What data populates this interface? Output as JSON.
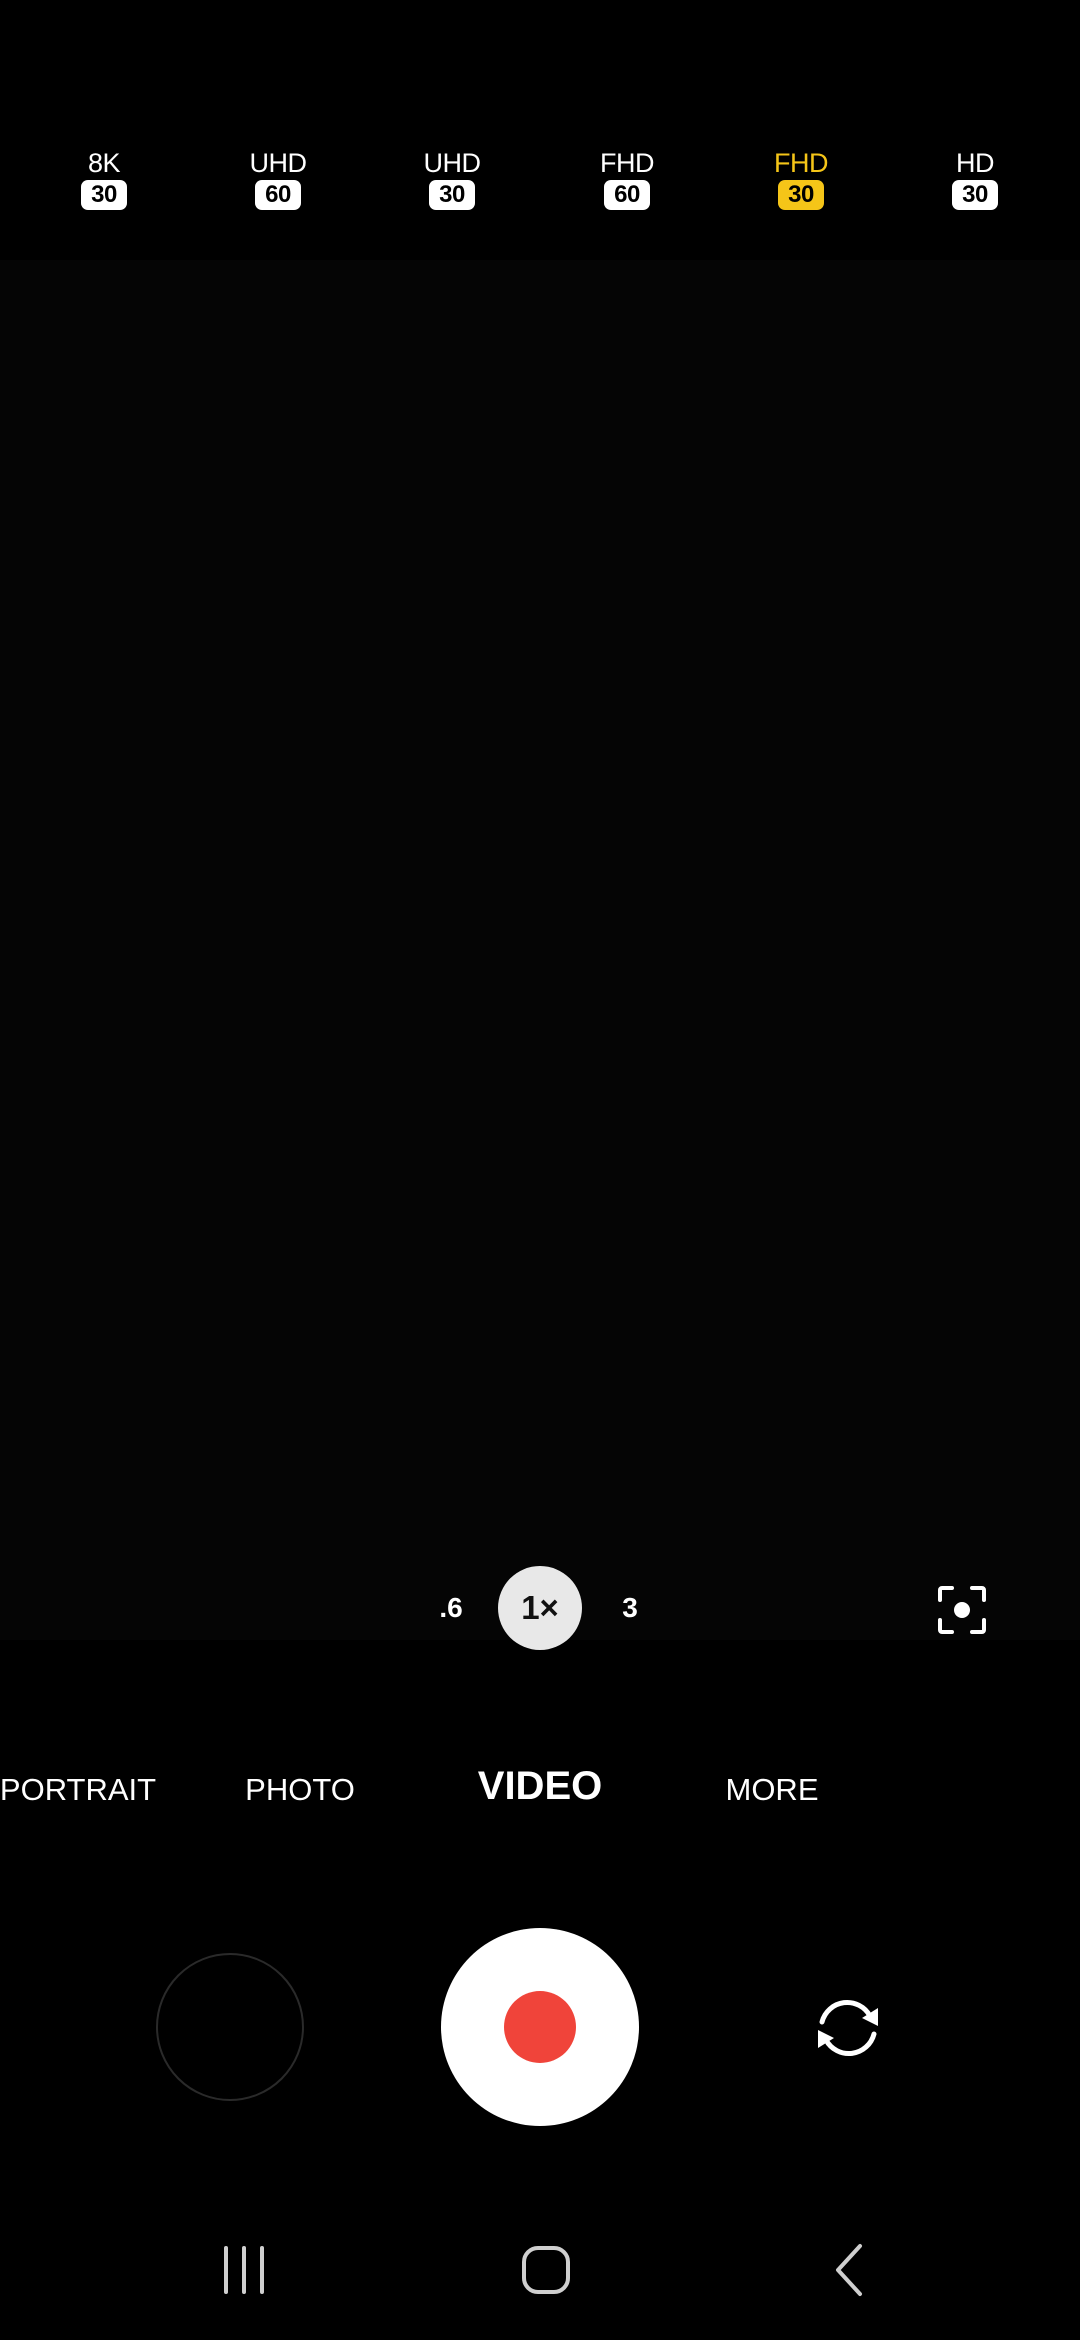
{
  "colors": {
    "accent": "#f5c518",
    "record": "#f0443a"
  },
  "resolutions": [
    {
      "label": "8K",
      "fps": "30",
      "selected": false
    },
    {
      "label": "UHD",
      "fps": "60",
      "selected": false
    },
    {
      "label": "UHD",
      "fps": "30",
      "selected": false
    },
    {
      "label": "FHD",
      "fps": "60",
      "selected": false
    },
    {
      "label": "FHD",
      "fps": "30",
      "selected": true
    },
    {
      "label": "HD",
      "fps": "30",
      "selected": false
    }
  ],
  "zoom": {
    "options": [
      ".6",
      "1×",
      "3"
    ],
    "active": "1×"
  },
  "modes": {
    "items": [
      "PORTRAIT",
      "PHOTO",
      "VIDEO",
      "MORE"
    ],
    "active": "VIDEO"
  },
  "icons": {
    "auto_focus": "auto-focus-icon",
    "record": "record-icon",
    "flip_camera": "flip-camera-icon",
    "recents": "recents-icon",
    "home": "home-icon",
    "back": "back-icon"
  }
}
